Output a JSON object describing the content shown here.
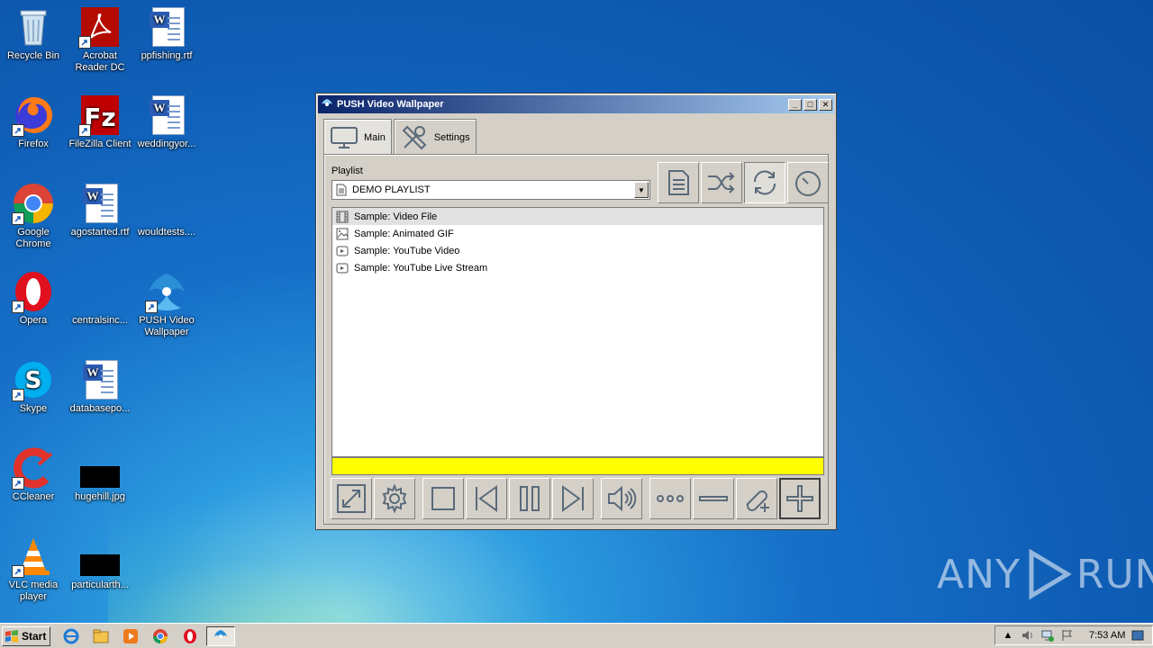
{
  "desktop": {
    "icons": [
      {
        "label": "Recycle Bin"
      },
      {
        "label": "Acrobat Reader DC"
      },
      {
        "label": "ppfishing.rtf"
      },
      {
        "label": "Firefox"
      },
      {
        "label": "FileZilla Client"
      },
      {
        "label": "weddingyor..."
      },
      {
        "label": "Google Chrome"
      },
      {
        "label": "agostarted.rtf"
      },
      {
        "label": "wouldtests...."
      },
      {
        "label": "Opera"
      },
      {
        "label": "centralsinc..."
      },
      {
        "label": "PUSH Video Wallpaper"
      },
      {
        "label": "Skype"
      },
      {
        "label": "databasepo..."
      },
      {
        "label": "CCleaner"
      },
      {
        "label": "hugehill.jpg"
      },
      {
        "label": "VLC media player"
      },
      {
        "label": "particularth..."
      }
    ]
  },
  "window": {
    "title": "PUSH Video Wallpaper",
    "tabs": [
      {
        "label": "Main"
      },
      {
        "label": "Settings"
      }
    ],
    "playlist_label": "Playlist",
    "playlist_selected": "DEMO PLAYLIST",
    "items": [
      {
        "label": "Sample: Video File",
        "icon": "film-icon"
      },
      {
        "label": "Sample: Animated GIF",
        "icon": "image-icon"
      },
      {
        "label": "Sample: YouTube Video",
        "icon": "play-icon"
      },
      {
        "label": "Sample: YouTube Live Stream",
        "icon": "play-icon"
      }
    ],
    "status_color": "#ffff00"
  },
  "taskbar": {
    "start_label": "Start",
    "clock": "7:53 AM"
  },
  "watermark": {
    "left": "ANY",
    "right": "RUN"
  }
}
